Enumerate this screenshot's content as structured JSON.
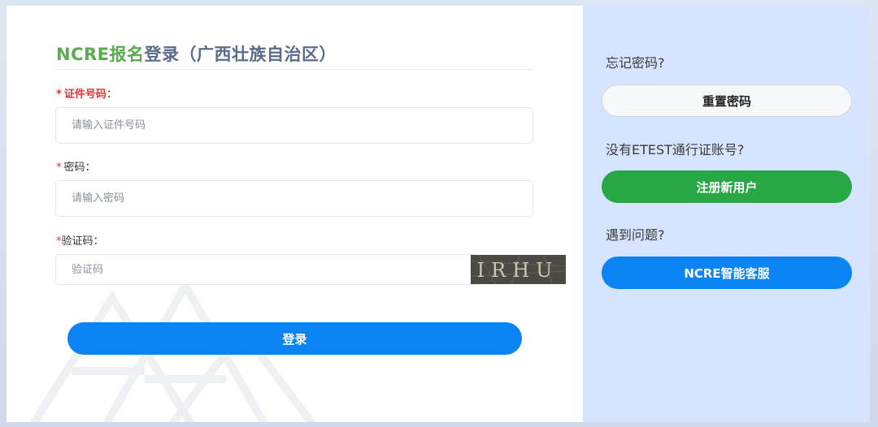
{
  "login": {
    "title_brand": "NCRE报名",
    "title_rest": "登录（广西壮族自治区）",
    "id_label": "证件号码",
    "id_placeholder": "请输入证件号码",
    "password_label": "密码",
    "password_placeholder": "请输入密码",
    "captcha_label": "验证码",
    "captcha_placeholder": "验证码",
    "captcha_text": "IRHU",
    "required_mark": "*",
    "label_suffix": "：",
    "login_button": "登录"
  },
  "side": {
    "forgot_question": "忘记密码?",
    "reset_button": "重置密码",
    "no_account_question": "没有ETEST通行证账号?",
    "register_button": "注册新用户",
    "problem_question": "遇到问题?",
    "service_button": "NCRE智能客服"
  },
  "colors": {
    "brand_green": "#5aaa4f",
    "primary_blue": "#0a84f5",
    "register_green": "#28a745",
    "required_red": "#e0343a",
    "side_bg": "#d7e4ff"
  }
}
